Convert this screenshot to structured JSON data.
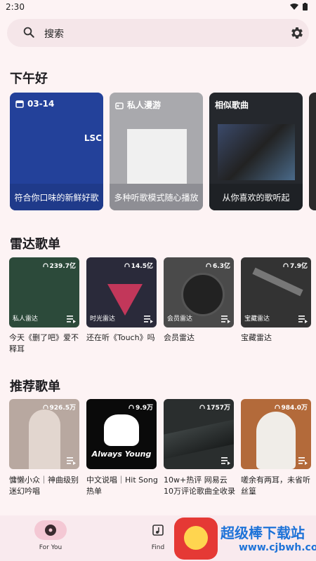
{
  "status": {
    "time": "2:30"
  },
  "search": {
    "placeholder": "搜索"
  },
  "greeting": "下午好",
  "featured": [
    {
      "head": "03-14",
      "art_text": "LSC",
      "footer": "符合你口味的新鲜好歌",
      "color": "#23419a"
    },
    {
      "head": "私人漫游",
      "footer": "多种听歌模式随心播放",
      "color": "#a9a9ad"
    },
    {
      "head": "相似歌曲",
      "footer": "从你喜欢的歌听起",
      "color": "#25282d"
    }
  ],
  "radar": {
    "title": "雷达歌单",
    "items": [
      {
        "plays": "239.7亿",
        "overlay": "私人雷达",
        "caption": "今天《删了吧》爱不释耳",
        "bg": "#2c4a3a"
      },
      {
        "plays": "14.5亿",
        "overlay": "时光雷达",
        "caption": "还在听《Touch》吗",
        "bg": "#2a2a3a"
      },
      {
        "plays": "6.3亿",
        "overlay": "会员雷达",
        "caption": "会员雷达",
        "bg": "#4a4a4a"
      },
      {
        "plays": "7.9亿",
        "overlay": "宝藏雷达",
        "caption": "宝藏雷达",
        "bg": "#333333"
      }
    ]
  },
  "recommend": {
    "title": "推荐歌单",
    "items": [
      {
        "plays": "926.5万",
        "caption": "慵懒小众｜神曲级别迷幻吟唱",
        "bg": "#b8a8a0"
      },
      {
        "plays": "9.9万",
        "art_text": "Always Young",
        "caption": "中文说唱｜Hit Song热单",
        "bg": "#0a0a0a"
      },
      {
        "plays": "1757万",
        "caption": "10w+热评 网易云10万评论歌曲全收录",
        "bg": "#2a2e2e"
      },
      {
        "plays": "984.0万",
        "caption": "嗟余有两耳，未省听丝篁",
        "bg": "#b36a3a"
      }
    ]
  },
  "nav": {
    "for_you": "For You",
    "find": "Find"
  },
  "watermark": {
    "text": "超级棒下载站",
    "url": "www.cjbwh.com"
  }
}
